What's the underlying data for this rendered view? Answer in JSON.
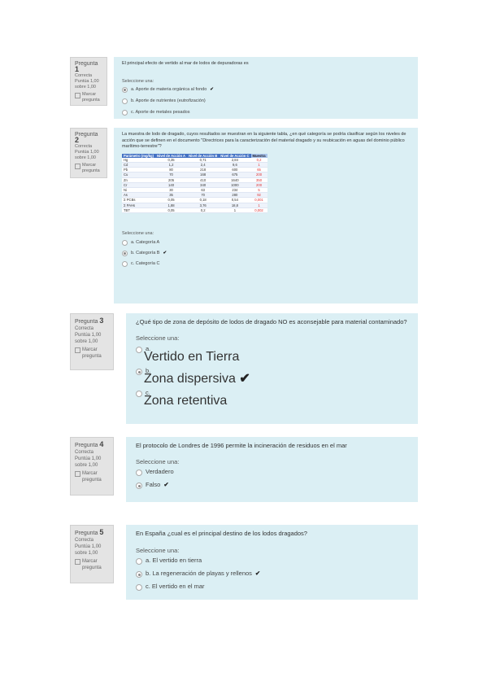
{
  "questions": [
    {
      "number_label": "Pregunta",
      "number": "1",
      "status": "Correcta",
      "score_line1": "Puntúa 1,00",
      "score_line2": "sobre 1,00",
      "flag_label": "Marcar pregunta",
      "text": "El principal efecto de vertido al mar de lodos de depuradoras es",
      "prompt": "Seleccione una:",
      "options": [
        {
          "label": "a. Aporte de materia orgánica al fondo",
          "selected": true,
          "correct_mark": true
        },
        {
          "label": "b. Aporte de nutrientes (eutrofización)",
          "selected": false,
          "correct_mark": false
        },
        {
          "label": "c. Aporte de metales pesados",
          "selected": false,
          "correct_mark": false
        }
      ]
    },
    {
      "number_label": "Pregunta",
      "number": "2",
      "status": "Correcta",
      "score_line1": "Puntúa 1,00",
      "score_line2": "sobre 1,00",
      "flag_label": "Marcar pregunta",
      "text": "La muestra de lodo de dragado, cuyos resultados se muestran en la siguiente tabla, ¿en qué categoría se podría clasificar según los niveles de acción que se definen en el documento \"Directrices para la caracterización del material dragado y su reubicación en aguas del dominio público marítimo-terrestre\"?",
      "table": {
        "headers": [
          "Parámetro (mg/kg)",
          "Nivel de Acción A",
          "Nivel de Acción B",
          "Nivel de Acción C",
          "Muestra"
        ],
        "rows": [
          {
            "cells": [
              "Hg",
              "0,35",
              "0,71",
              "2,84",
              "0,2"
            ],
            "red": true
          },
          {
            "cells": [
              "Cd",
              "1,2",
              "2,4",
              "9,6",
              "1"
            ],
            "red": true
          },
          {
            "cells": [
              "Pb",
              "80",
              "218",
              "600",
              "65"
            ],
            "red": true
          },
          {
            "cells": [
              "Cu",
              "70",
              "168",
              "675",
              "200"
            ],
            "red": true
          },
          {
            "cells": [
              "Zn",
              "205",
              "410",
              "1640",
              "350"
            ],
            "red": true
          },
          {
            "cells": [
              "Cr",
              "140",
              "340",
              "1000",
              "200"
            ],
            "red": true
          },
          {
            "cells": [
              "Ni",
              "30",
              "63",
              "234",
              "5"
            ],
            "red": true
          },
          {
            "cells": [
              "As",
              "35",
              "70",
              "280",
              "92"
            ],
            "red": true
          },
          {
            "cells": [
              "Σ PCBs",
              "0,05",
              "0,18",
              "0,54",
              "0,001"
            ],
            "red": true
          },
          {
            "cells": [
              "Σ PAHs",
              "1,88",
              "3,76",
              "18,8",
              "1"
            ],
            "red": true
          },
          {
            "cells": [
              "TBT",
              "0,05",
              "0,2",
              "1",
              "0,002"
            ],
            "red": true
          }
        ]
      },
      "prompt": "Seleccione una:",
      "options": [
        {
          "label": "a. Categoría A",
          "selected": false,
          "correct_mark": false
        },
        {
          "label": "b. Categoría B",
          "selected": true,
          "correct_mark": true
        },
        {
          "label": "c. Categoría C",
          "selected": false,
          "correct_mark": false
        }
      ]
    },
    {
      "number_label": "Pregunta",
      "number": "3",
      "status": "Correcta",
      "score_line1": "Puntúa 1,00",
      "score_line2": "sobre 1,00",
      "flag_label": "Marcar pregunta",
      "text": "¿Qué tipo de zona de depósito de lodos de dragado NO es aconsejable para material contaminado?",
      "prompt": "Seleccione una:",
      "options": [
        {
          "letter": "a.",
          "label": "Vertido en Tierra",
          "selected": false,
          "correct_mark": false
        },
        {
          "letter": "b.",
          "label": "Zona dispersiva",
          "selected": true,
          "correct_mark": true
        },
        {
          "letter": "c.",
          "label": "Zona retentiva",
          "selected": false,
          "correct_mark": false
        }
      ]
    },
    {
      "number_label": "Pregunta",
      "number": "4",
      "status": "Correcta",
      "score_line1": "Puntúa 1,00",
      "score_line2": "sobre 1,00",
      "flag_label": "Marcar pregunta",
      "text": "El protocolo de Londres de 1996 permite la incineración de residuos en el mar",
      "prompt": "Seleccione una:",
      "options": [
        {
          "label": "Verdadero",
          "selected": false,
          "correct_mark": false
        },
        {
          "label": "Falso",
          "selected": true,
          "correct_mark": true
        }
      ]
    },
    {
      "number_label": "Pregunta",
      "number": "5",
      "status": "Correcta",
      "score_line1": "Puntúa 1,00",
      "score_line2": "sobre 1,00",
      "flag_label": "Marcar pregunta",
      "text": "En España ¿cual es el principal destino de los lodos dragados?",
      "prompt": "Seleccione una:",
      "options": [
        {
          "label": "a. El vertido en tierra",
          "selected": false,
          "correct_mark": false
        },
        {
          "label": "b. La regeneración de playas y rellenos",
          "selected": true,
          "correct_mark": true
        },
        {
          "label": "c. El vertido en el mar",
          "selected": false,
          "correct_mark": false
        }
      ]
    }
  ],
  "icons": {
    "check": "check-icon",
    "flag": "flag-icon"
  },
  "colors": {
    "info_bg": "#e4e4e4",
    "content_bg": "#dbeff4",
    "table_header": "#4472c4",
    "red_value": "#e03030"
  }
}
